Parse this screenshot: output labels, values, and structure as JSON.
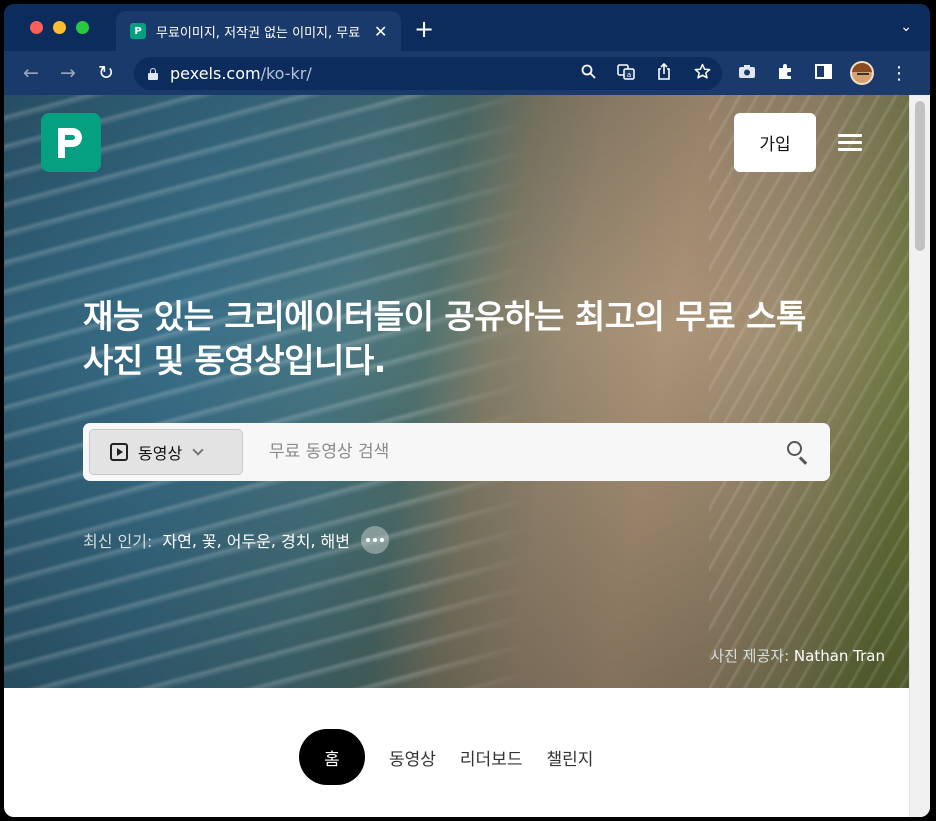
{
  "browser": {
    "tab_title": "무료이미지, 저작권 없는 이미지, 무료",
    "tab_close": "✕",
    "new_tab": "+",
    "tab_menu": "⌄",
    "url_host": "pexels.com",
    "url_path": "/ko-kr/",
    "nav_back": "←",
    "nav_forward": "→",
    "nav_reload": "↻",
    "omnibox_icons": [
      "zoom-icon",
      "translate-icon",
      "share-icon",
      "bookmark-star-icon"
    ],
    "toolbar_icons": [
      "camera-icon",
      "extensions-icon",
      "sidepanel-icon"
    ],
    "kebab": "⋮"
  },
  "header": {
    "join_label": "가입"
  },
  "hero": {
    "headline": "재능 있는 크리에이터들이 공유하는 최고의 무료 스톡 사진 및 동영상입니다.",
    "search": {
      "type_label": "동영상",
      "placeholder": "무료 동영상 검색"
    },
    "trending": {
      "label": "최신 인기:",
      "items": [
        "자연",
        "꽃",
        "어두운",
        "경치",
        "해변"
      ]
    },
    "credit": {
      "prefix": "사진 제공자:",
      "name": "Nathan Tran"
    }
  },
  "nav": {
    "tabs": [
      "홈",
      "동영상",
      "리더보드",
      "챌린지"
    ],
    "active": "홈"
  },
  "colors": {
    "brand": "#05a081",
    "chrome_frame": "#0c2c5e",
    "chrome_toolbar": "#1a3a6b"
  }
}
